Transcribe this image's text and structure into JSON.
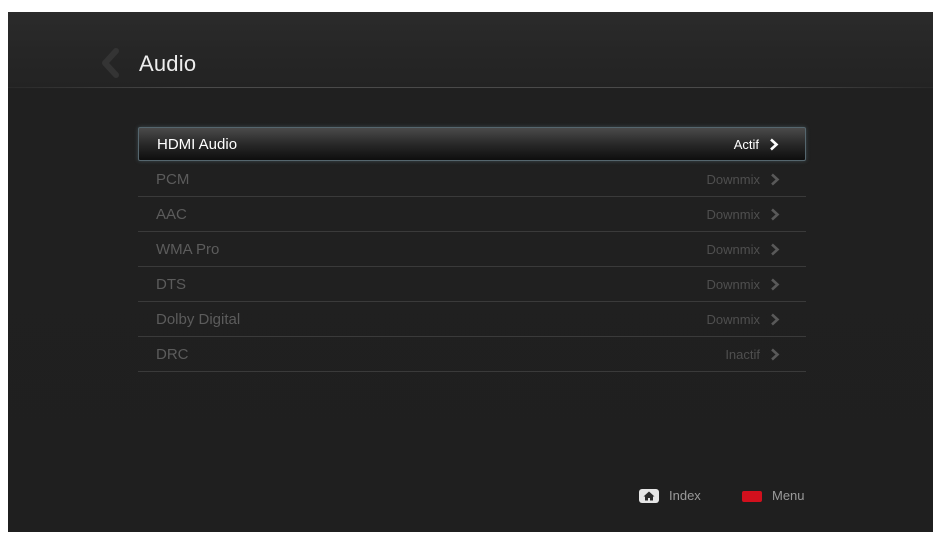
{
  "header": {
    "title": "Audio",
    "back_icon": "chevron-left-icon"
  },
  "settings": [
    {
      "label": "HDMI Audio",
      "value": "Actif",
      "selected": true
    },
    {
      "label": "PCM",
      "value": "Downmix",
      "selected": false
    },
    {
      "label": "AAC",
      "value": "Downmix",
      "selected": false
    },
    {
      "label": "WMA Pro",
      "value": "Downmix",
      "selected": false
    },
    {
      "label": "DTS",
      "value": "Downmix",
      "selected": false
    },
    {
      "label": "Dolby Digital",
      "value": "Downmix",
      "selected": false
    },
    {
      "label": "DRC",
      "value": "Inactif",
      "selected": false
    }
  ],
  "footer": {
    "index_label": "Index",
    "index_icon": "home-icon",
    "menu_label": "Menu",
    "menu_icon": "red-button-icon"
  },
  "colors": {
    "background": "#1f1f1f",
    "selected_text": "#ffffff",
    "dim_text": "#5c5c5c",
    "menu_key": "#d1101d"
  }
}
